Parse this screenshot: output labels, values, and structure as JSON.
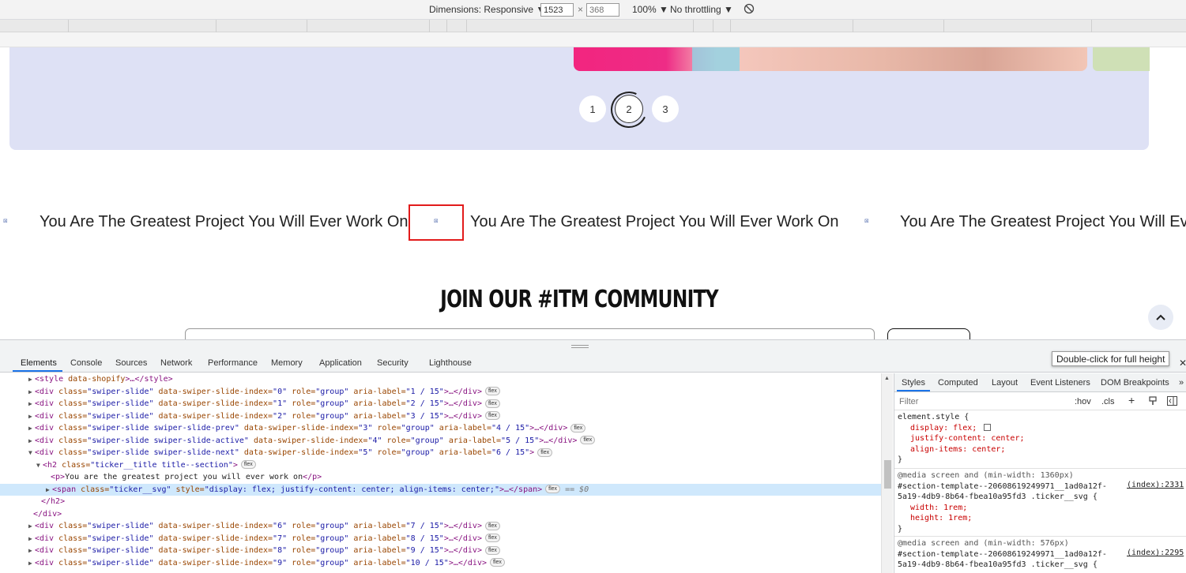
{
  "device_toolbar": {
    "dimensions_label": "Dimensions: Responsive ▼",
    "width_value": "1523",
    "times_sign": "×",
    "height_placeholder": "368",
    "zoom": "100% ▼",
    "throttling": "No throttling ▼"
  },
  "page": {
    "pagination": [
      "1",
      "2",
      "3"
    ],
    "ticker_text": "You Are The Greatest Project You Will Ever Work On",
    "ticker_text_cut": "You Are The Greatest Project You Will Ev",
    "ticker_icon_glyph": "⊠",
    "join_title": "JOIN OUR #ITM COMMUNITY",
    "scroll_top_glyph": "⌃"
  },
  "devtools": {
    "tabs": [
      "Elements",
      "Console",
      "Sources",
      "Network",
      "Performance",
      "Memory",
      "Application",
      "Security",
      "Lighthouse"
    ],
    "tooltip": "Double-click for full height",
    "close_glyph": "✕",
    "dom_lines": [
      {
        "tri": "▶",
        "tag_open": "<style ",
        "attr": "data-shopify",
        "rest": ">…</style>",
        "badge": ""
      },
      {
        "tri": "▶",
        "tag_open": "<div ",
        "attr": "class=",
        "val": "\"swiper-slide\"",
        "attr2": " data-swiper-slide-index=",
        "val2": "\"0\"",
        "attr3": " role=",
        "val3": "\"group\"",
        "attr4": " aria-label=",
        "val4": "\"1 / 15\"",
        "rest": ">…</div>",
        "badge": "flex"
      },
      {
        "tri": "▶",
        "tag_open": "<div ",
        "attr": "class=",
        "val": "\"swiper-slide\"",
        "attr2": " data-swiper-slide-index=",
        "val2": "\"1\"",
        "attr3": " role=",
        "val3": "\"group\"",
        "attr4": " aria-label=",
        "val4": "\"2 / 15\"",
        "rest": ">…</div>",
        "badge": "flex"
      },
      {
        "tri": "▶",
        "tag_open": "<div ",
        "attr": "class=",
        "val": "\"swiper-slide\"",
        "attr2": " data-swiper-slide-index=",
        "val2": "\"2\"",
        "attr3": " role=",
        "val3": "\"group\"",
        "attr4": " aria-label=",
        "val4": "\"3 / 15\"",
        "rest": ">…</div>",
        "badge": "flex"
      },
      {
        "tri": "▶",
        "tag_open": "<div ",
        "attr": "class=",
        "val": "\"swiper-slide swiper-slide-prev\"",
        "attr2": " data-swiper-slide-index=",
        "val2": "\"3\"",
        "attr3": " role=",
        "val3": "\"group\"",
        "attr4": " aria-label=",
        "val4": "\"4 / 15\"",
        "rest": ">…</div>",
        "badge": "flex"
      },
      {
        "tri": "▶",
        "tag_open": "<div ",
        "attr": "class=",
        "val": "\"swiper-slide swiper-slide-active\"",
        "attr2": " data-swiper-slide-index=",
        "val2": "\"4\"",
        "attr3": " role=",
        "val3": "\"group\"",
        "attr4": " aria-label=",
        "val4": "\"5 / 15\"",
        "rest": ">…</div>",
        "badge": "flex"
      },
      {
        "tri": "▼",
        "tag_open": "<div ",
        "attr": "class=",
        "val": "\"swiper-slide swiper-slide-next\"",
        "attr2": " data-swiper-slide-index=",
        "val2": "\"5\"",
        "attr3": " role=",
        "val3": "\"group\"",
        "attr4": " aria-label=",
        "val4": "\"6 / 15\"",
        "rest": ">",
        "badge": "flex"
      },
      {
        "tri": "▼",
        "tag_open": "<h2 ",
        "attr": "class=",
        "val": "\"ticker__title title--section\"",
        "rest": ">",
        "badge": "flex"
      },
      {
        "tri": "",
        "tag_open": "<p>",
        "text": "You are the greatest project you will ever work on",
        "rest": "</p>",
        "badge": ""
      },
      {
        "tri": "▶",
        "tag_open": "<span ",
        "attr": "class=",
        "val": "\"ticker__svg\"",
        "attr2": " style=",
        "val2": "\"display: flex; justify-content: center; align-items: center;\"",
        "rest": ">…</span>",
        "badge": "flex",
        "selected": "== $0"
      },
      {
        "tri": "",
        "tag_open": "</h2>",
        "rest": "",
        "badge": ""
      },
      {
        "tri": "",
        "tag_open": "</div>",
        "rest": "",
        "badge": ""
      },
      {
        "tri": "▶",
        "tag_open": "<div ",
        "attr": "class=",
        "val": "\"swiper-slide\"",
        "attr2": " data-swiper-slide-index=",
        "val2": "\"6\"",
        "attr3": " role=",
        "val3": "\"group\"",
        "attr4": " aria-label=",
        "val4": "\"7 / 15\"",
        "rest": ">…</div>",
        "badge": "flex"
      },
      {
        "tri": "▶",
        "tag_open": "<div ",
        "attr": "class=",
        "val": "\"swiper-slide\"",
        "attr2": " data-swiper-slide-index=",
        "val2": "\"7\"",
        "attr3": " role=",
        "val3": "\"group\"",
        "attr4": " aria-label=",
        "val4": "\"8 / 15\"",
        "rest": ">…</div>",
        "badge": "flex"
      },
      {
        "tri": "▶",
        "tag_open": "<div ",
        "attr": "class=",
        "val": "\"swiper-slide\"",
        "attr2": " data-swiper-slide-index=",
        "val2": "\"8\"",
        "attr3": " role=",
        "val3": "\"group\"",
        "attr4": " aria-label=",
        "val4": "\"9 / 15\"",
        "rest": ">…</div>",
        "badge": "flex"
      },
      {
        "tri": "▶",
        "tag_open": "<div ",
        "attr": "class=",
        "val": "\"swiper-slide\"",
        "attr2": " data-swiper-slide-index=",
        "val2": "\"9\"",
        "attr3": " role=",
        "val3": "\"group\"",
        "attr4": " aria-label=",
        "val4": "\"10 / 15\"",
        "rest": ">…</div>",
        "badge": "flex"
      }
    ],
    "styles_tabs": [
      "Styles",
      "Computed",
      "Layout",
      "Event Listeners",
      "DOM Breakpoints",
      "»"
    ],
    "filter_placeholder": "Filter",
    "hov": ":hov",
    "cls": ".cls",
    "plus": "+",
    "rules": {
      "element_style": "element.style {",
      "es_props": [
        "display: flex;",
        "justify-content: center;",
        "align-items: center;"
      ],
      "close": "}",
      "media1": "@media screen and (min-width: 1360px)",
      "sel1a": "#section-template--20608619249971__1ad0a12f-",
      "sel1b": "5a19-4db9-8b64-fbea10a95fd3 .ticker__svg {",
      "src1": "(index):2331",
      "props1": [
        "width: 1rem;",
        "height: 1rem;"
      ],
      "media2": "@media screen and (min-width: 576px)",
      "sel2a": "#section-template--20608619249971__1ad0a12f-",
      "sel2b": "5a19-4db9-8b64-fbea10a95fd3 .ticker__svg {",
      "src2": "(index):2295"
    }
  }
}
